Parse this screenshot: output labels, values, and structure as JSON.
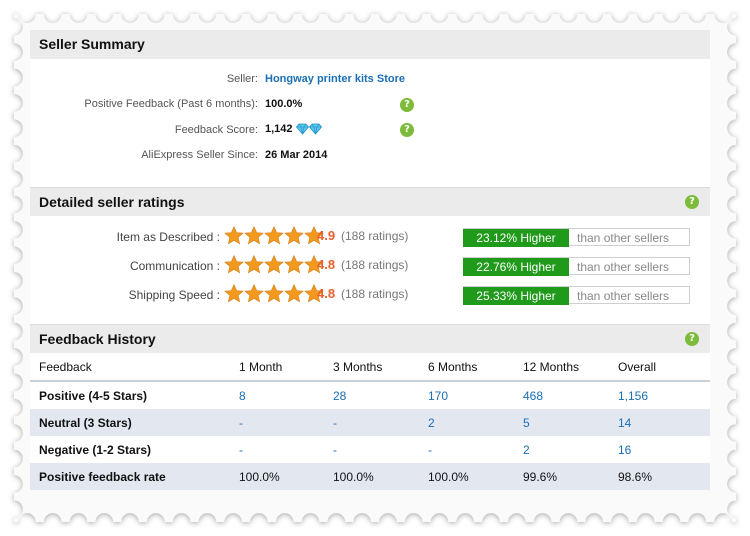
{
  "seller_summary": {
    "title": "Seller Summary",
    "seller_label": "Seller:",
    "seller_name": "Hongway printer kits Store",
    "positive_label": "Positive Feedback (Past 6 months):",
    "positive_value": "100.0%",
    "score_label": "Feedback Score:",
    "score_value": "1,142",
    "since_label": "AliExpress Seller Since:",
    "since_value": "26 Mar 2014"
  },
  "detailed_ratings": {
    "title": "Detailed seller ratings",
    "rows": [
      {
        "label": "Item as Described :",
        "score": "4.9",
        "count": "(188 ratings)",
        "compare": "23.12% Higher",
        "suffix": "than other sellers",
        "stars": 5
      },
      {
        "label": "Communication :",
        "score": "4.8",
        "count": "(188 ratings)",
        "compare": "22.76% Higher",
        "suffix": "than other sellers",
        "stars": 5
      },
      {
        "label": "Shipping Speed :",
        "score": "4.8",
        "count": "(188 ratings)",
        "compare": "25.33% Higher",
        "suffix": "than other sellers",
        "stars": 5
      }
    ]
  },
  "feedback_history": {
    "title": "Feedback History",
    "headers": [
      "Feedback",
      "1 Month",
      "3 Months",
      "6 Months",
      "12 Months",
      "Overall"
    ],
    "rows": [
      [
        "Positive (4-5 Stars)",
        "8",
        "28",
        "170",
        "468",
        "1,156"
      ],
      [
        "Neutral (3 Stars)",
        "-",
        "-",
        "2",
        "5",
        "14"
      ],
      [
        "Negative (1-2 Stars)",
        "-",
        "-",
        "-",
        "2",
        "16"
      ],
      [
        "Positive feedback rate",
        "100.0%",
        "100.0%",
        "100.0%",
        "99.6%",
        "98.6%"
      ]
    ]
  },
  "help_glyph": "?",
  "colors": {
    "accent_link": "#1a6fb5",
    "score_orange": "#e8612c",
    "bar_green": "#1f9a1a",
    "help_green": "#7dbb3a",
    "star_orange": "#f39a1e"
  }
}
